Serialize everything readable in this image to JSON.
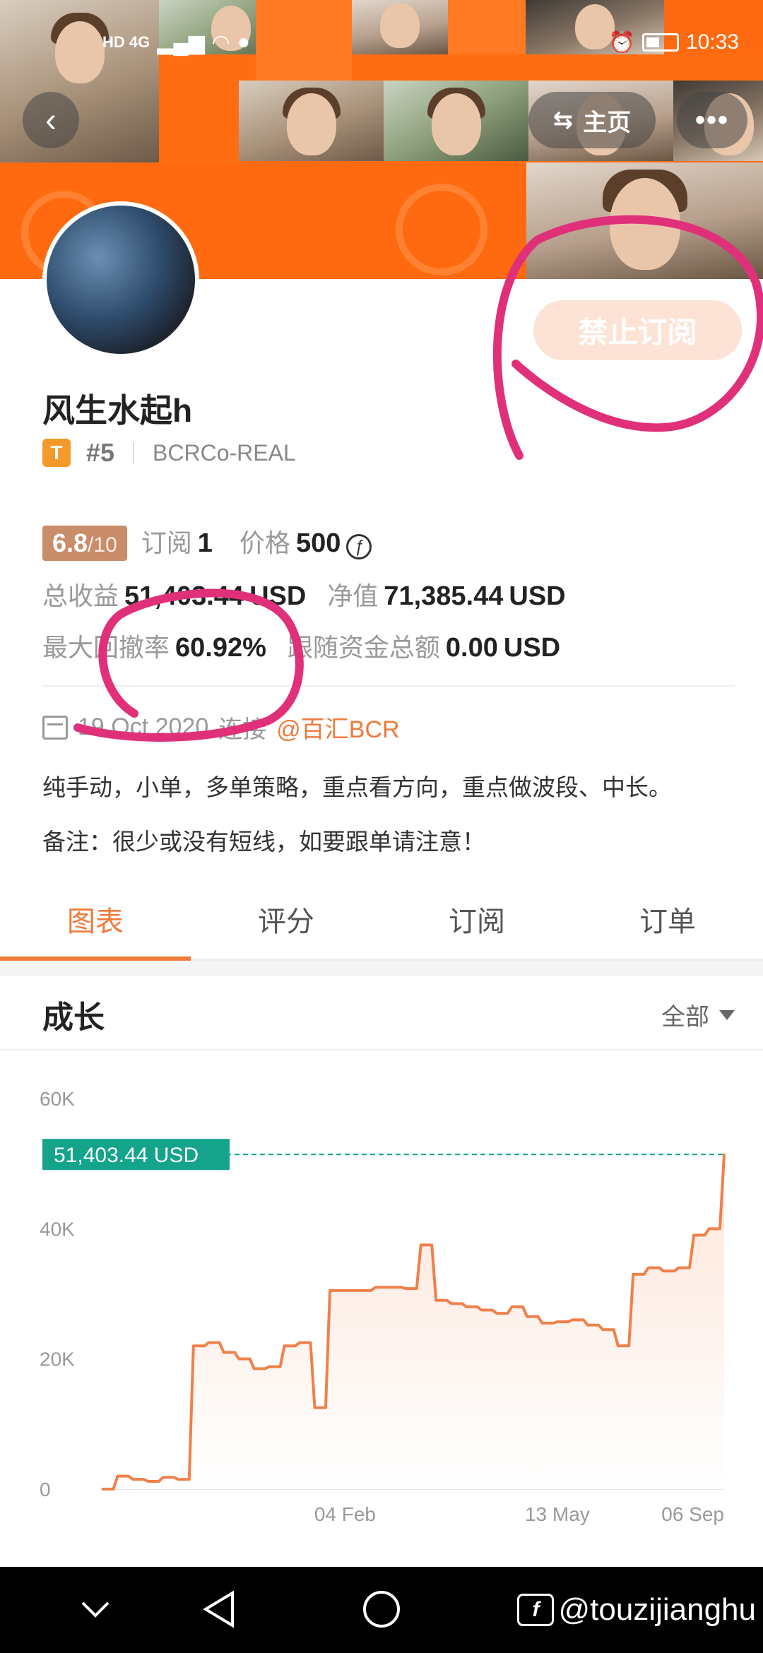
{
  "status_bar": {
    "network_left": "HD 4G",
    "time": "10:33"
  },
  "header": {
    "back_icon": "chevron-left-icon",
    "home_label": "主页",
    "home_icon": "swap-arrows-icon",
    "more_icon": "more-dots-icon"
  },
  "profile": {
    "name": "风生水起h",
    "badge": "T",
    "rank": "#5",
    "account": "BCRCo-REAL",
    "subscribe_button": "禁止订阅"
  },
  "stats": {
    "score": "6.8",
    "score_max": "/10",
    "subscribe_label": "订阅",
    "subscribe_count": "1",
    "price_label": "价格",
    "price_value": "500",
    "price_icon": "ƒ",
    "total_profit_label": "总收益",
    "total_profit_value": "51,403.44",
    "currency": "USD",
    "net_value_label": "净值",
    "net_value_value": "71,385.44",
    "max_drawdown_label": "最大回撤率",
    "max_drawdown_value": "60.92%",
    "follow_funds_label": "跟随资金总额",
    "follow_funds_value": "0.00"
  },
  "connection": {
    "date": "19 Oct 2020",
    "action": "连接",
    "broker": "@百汇BCR"
  },
  "description": {
    "line1": "纯手动，小单，多单策略，重点看方向，重点做波段、中长。",
    "line2": "备注：很少或没有短线，如要跟单请注意！"
  },
  "tabs": [
    "图表",
    "评分",
    "订阅",
    "订单"
  ],
  "section": {
    "title": "成长",
    "filter": "全部"
  },
  "chart_data": {
    "type": "area",
    "title": "成长",
    "y_ticks": [
      "0",
      "20K",
      "40K",
      "60K"
    ],
    "ylim": [
      0,
      60000
    ],
    "x_ticks": [
      "04 Feb",
      "13 May",
      "06 Sep"
    ],
    "current_label": "51,403.44 USD",
    "current_value": 51403.44,
    "series": [
      {
        "values": [
          0,
          2000,
          1500,
          1200,
          1800,
          1500,
          22000,
          22500,
          21000,
          20000,
          18500,
          18800,
          22000,
          22500,
          12500,
          30500,
          30500,
          30500,
          31000,
          31000,
          30800,
          37500,
          29000,
          28500,
          28000,
          27500,
          27000,
          28000,
          26500,
          25500,
          25700,
          26000,
          25200,
          24500,
          22000,
          33000,
          34000,
          33500,
          34000,
          39000,
          40000,
          51403.44
        ]
      }
    ],
    "grid": false,
    "colors": {
      "line": "#f0804a",
      "fill": "#fde3d6",
      "label_bg": "#14a38b"
    }
  },
  "watermark": "@touzijianghu",
  "annotations_color": "#e0307a"
}
